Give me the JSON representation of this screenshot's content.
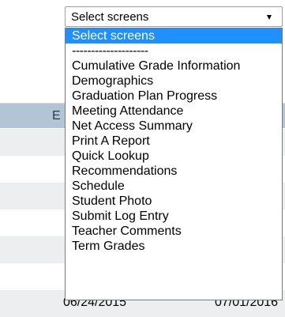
{
  "background_table": {
    "header_partial": "E",
    "cells": [
      "06/24/2015",
      "07/01/2016"
    ]
  },
  "screen_select": {
    "value": "Select screens",
    "arrow_icon": "chevron-down-icon"
  },
  "dropdown": {
    "highlight_color": "#1e90ff",
    "options": [
      {
        "label": "Select screens",
        "selected": true
      },
      {
        "label": "--------------------",
        "separator": true
      },
      {
        "label": "Cumulative Grade Information"
      },
      {
        "label": "Demographics"
      },
      {
        "label": "Graduation Plan Progress"
      },
      {
        "label": "Meeting Attendance"
      },
      {
        "label": "Net Access Summary"
      },
      {
        "label": "Print A Report"
      },
      {
        "label": "Quick Lookup"
      },
      {
        "label": "Recommendations"
      },
      {
        "label": "Schedule"
      },
      {
        "label": "Student Photo"
      },
      {
        "label": "Submit Log Entry"
      },
      {
        "label": "Teacher Comments"
      },
      {
        "label": "Term Grades"
      }
    ]
  }
}
